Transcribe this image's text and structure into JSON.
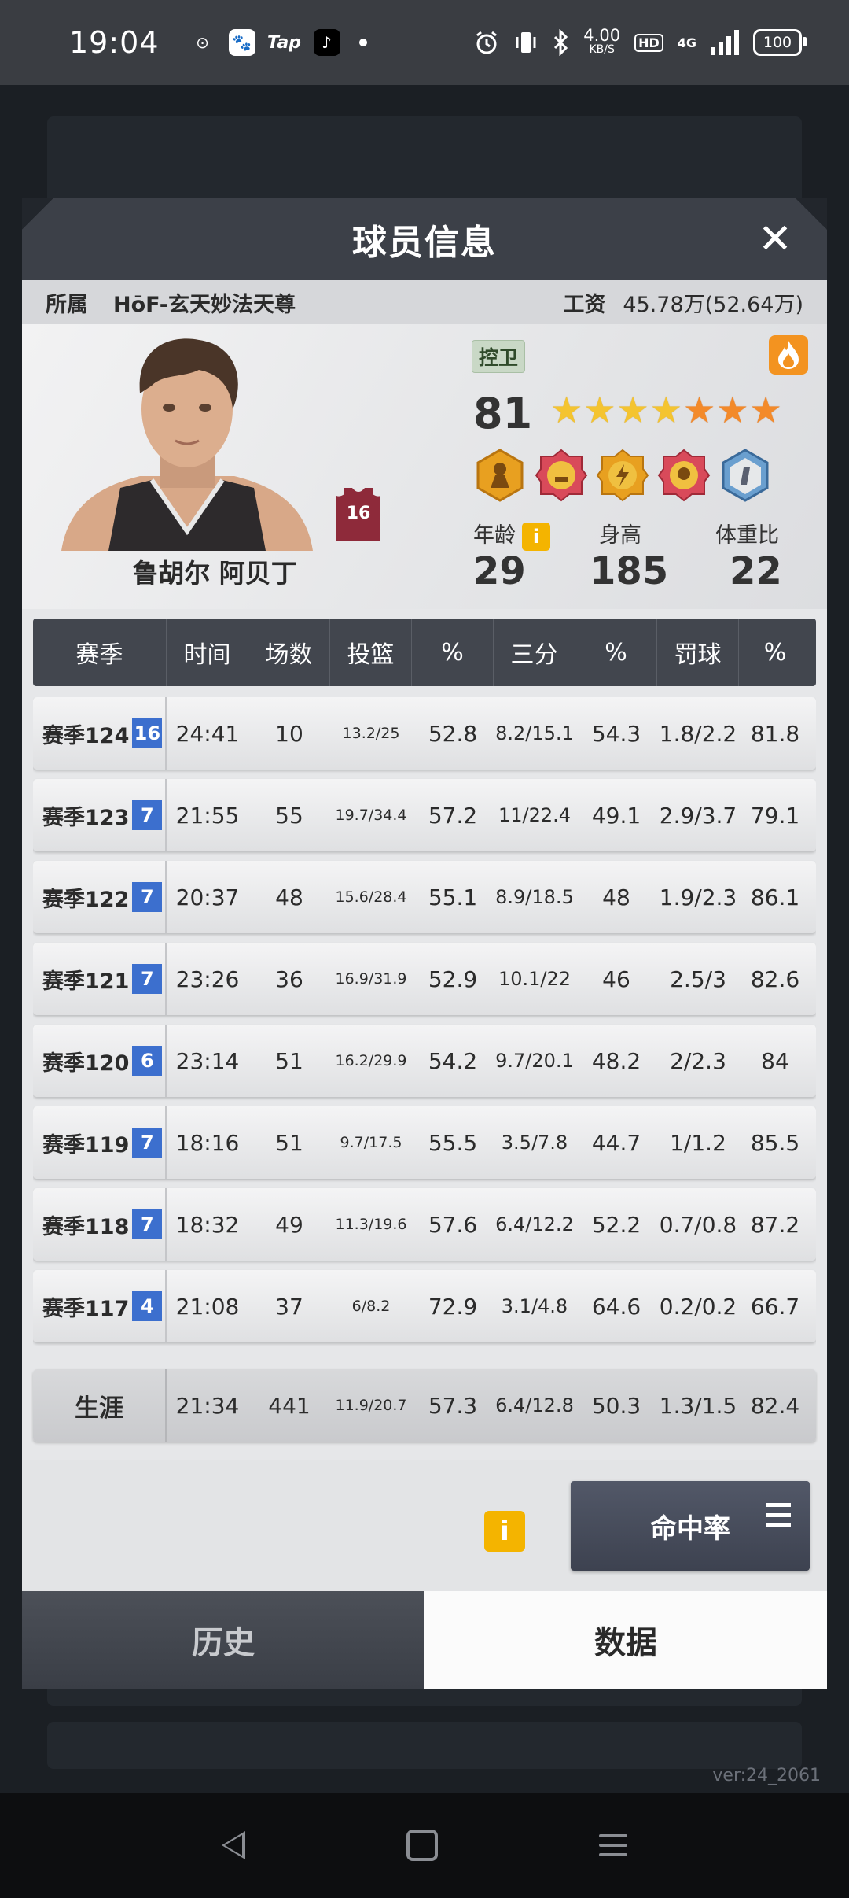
{
  "status_bar": {
    "time": "19:04",
    "app_icons": [
      "⊙",
      "🐾",
      "Tap",
      "♪"
    ],
    "net_speed_value": "4.00",
    "net_speed_unit": "KB/S",
    "hd": "HD",
    "net_type": "4G",
    "battery": "100"
  },
  "modal": {
    "title": "球员信息",
    "close": "✕",
    "team_label": "所属",
    "team_value": "HōF-玄天妙法天尊",
    "salary_label": "工资",
    "salary_value": "45.78万(52.64万)"
  },
  "player": {
    "name": "鲁胡尔 阿贝丁",
    "jersey_number": "16",
    "position": "控卫",
    "rating": "81",
    "stars": {
      "gold": 4,
      "orange": 3,
      "total": 7
    },
    "age_label": "年龄",
    "age_info": "i",
    "age": "29",
    "height_label": "身高",
    "height": "185",
    "weight_ratio_label": "体重比",
    "weight_ratio": "22"
  },
  "table": {
    "headers": [
      "赛季",
      "时间",
      "场数",
      "投篮",
      "%",
      "三分",
      "%",
      "罚球",
      "%"
    ],
    "rows": [
      {
        "season": "赛季124",
        "level": "16",
        "time": "24:41",
        "games": "10",
        "fg": "13.2/25",
        "fg_pct": "52.8",
        "three": "8.2/15.1",
        "three_pct": "54.3",
        "ft": "1.8/2.2",
        "ft_pct": "81.8"
      },
      {
        "season": "赛季123",
        "level": "7",
        "time": "21:55",
        "games": "55",
        "fg": "19.7/34.4",
        "fg_pct": "57.2",
        "three": "11/22.4",
        "three_pct": "49.1",
        "ft": "2.9/3.7",
        "ft_pct": "79.1"
      },
      {
        "season": "赛季122",
        "level": "7",
        "time": "20:37",
        "games": "48",
        "fg": "15.6/28.4",
        "fg_pct": "55.1",
        "three": "8.9/18.5",
        "three_pct": "48",
        "ft": "1.9/2.3",
        "ft_pct": "86.1"
      },
      {
        "season": "赛季121",
        "level": "7",
        "time": "23:26",
        "games": "36",
        "fg": "16.9/31.9",
        "fg_pct": "52.9",
        "three": "10.1/22",
        "three_pct": "46",
        "ft": "2.5/3",
        "ft_pct": "82.6"
      },
      {
        "season": "赛季120",
        "level": "6",
        "time": "23:14",
        "games": "51",
        "fg": "16.2/29.9",
        "fg_pct": "54.2",
        "three": "9.7/20.1",
        "three_pct": "48.2",
        "ft": "2/2.3",
        "ft_pct": "84"
      },
      {
        "season": "赛季119",
        "level": "7",
        "time": "18:16",
        "games": "51",
        "fg": "9.7/17.5",
        "fg_pct": "55.5",
        "three": "3.5/7.8",
        "three_pct": "44.7",
        "ft": "1/1.2",
        "ft_pct": "85.5"
      },
      {
        "season": "赛季118",
        "level": "7",
        "time": "18:32",
        "games": "49",
        "fg": "11.3/19.6",
        "fg_pct": "57.6",
        "three": "6.4/12.2",
        "three_pct": "52.2",
        "ft": "0.7/0.8",
        "ft_pct": "87.2"
      },
      {
        "season": "赛季117",
        "level": "4",
        "time": "21:08",
        "games": "37",
        "fg": "6/8.2",
        "fg_pct": "72.9",
        "three": "3.1/4.8",
        "three_pct": "64.6",
        "ft": "0.2/0.2",
        "ft_pct": "66.7"
      }
    ],
    "career": {
      "label": "生涯",
      "time": "21:34",
      "games": "441",
      "fg": "11.9/20.7",
      "fg_pct": "57.3",
      "three": "6.4/12.8",
      "three_pct": "50.3",
      "ft": "1.3/1.5",
      "ft_pct": "82.4"
    }
  },
  "controls": {
    "info": "i",
    "rate_button": "命中率"
  },
  "tabs": {
    "history": "历史",
    "data": "数据"
  },
  "version": "ver:24_2061",
  "colors": {
    "accent_blue": "#3c6fce",
    "info_yellow": "#f4b400",
    "fire_orange": "#f39320",
    "header_dark": "#3c4048"
  }
}
